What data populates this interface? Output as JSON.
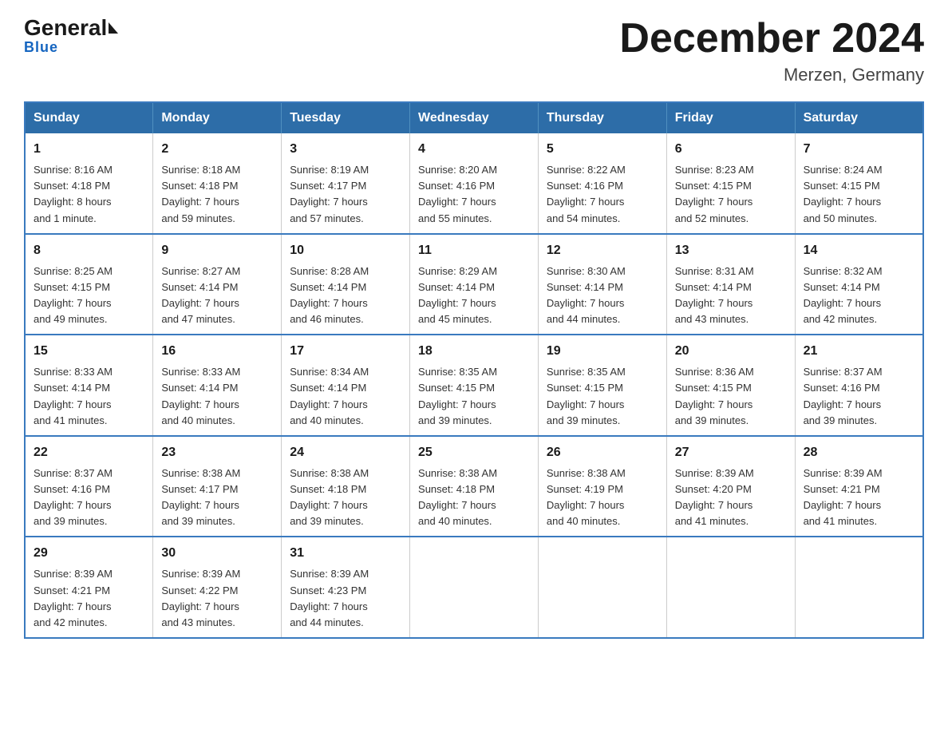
{
  "logo": {
    "text1": "General",
    "text2": "Blue"
  },
  "header": {
    "month_title": "December 2024",
    "location": "Merzen, Germany"
  },
  "days_of_week": [
    "Sunday",
    "Monday",
    "Tuesday",
    "Wednesday",
    "Thursday",
    "Friday",
    "Saturday"
  ],
  "weeks": [
    [
      {
        "day": "1",
        "sunrise": "8:16 AM",
        "sunset": "4:18 PM",
        "daylight": "8 hours and 1 minute."
      },
      {
        "day": "2",
        "sunrise": "8:18 AM",
        "sunset": "4:18 PM",
        "daylight": "7 hours and 59 minutes."
      },
      {
        "day": "3",
        "sunrise": "8:19 AM",
        "sunset": "4:17 PM",
        "daylight": "7 hours and 57 minutes."
      },
      {
        "day": "4",
        "sunrise": "8:20 AM",
        "sunset": "4:16 PM",
        "daylight": "7 hours and 55 minutes."
      },
      {
        "day": "5",
        "sunrise": "8:22 AM",
        "sunset": "4:16 PM",
        "daylight": "7 hours and 54 minutes."
      },
      {
        "day": "6",
        "sunrise": "8:23 AM",
        "sunset": "4:15 PM",
        "daylight": "7 hours and 52 minutes."
      },
      {
        "day": "7",
        "sunrise": "8:24 AM",
        "sunset": "4:15 PM",
        "daylight": "7 hours and 50 minutes."
      }
    ],
    [
      {
        "day": "8",
        "sunrise": "8:25 AM",
        "sunset": "4:15 PM",
        "daylight": "7 hours and 49 minutes."
      },
      {
        "day": "9",
        "sunrise": "8:27 AM",
        "sunset": "4:14 PM",
        "daylight": "7 hours and 47 minutes."
      },
      {
        "day": "10",
        "sunrise": "8:28 AM",
        "sunset": "4:14 PM",
        "daylight": "7 hours and 46 minutes."
      },
      {
        "day": "11",
        "sunrise": "8:29 AM",
        "sunset": "4:14 PM",
        "daylight": "7 hours and 45 minutes."
      },
      {
        "day": "12",
        "sunrise": "8:30 AM",
        "sunset": "4:14 PM",
        "daylight": "7 hours and 44 minutes."
      },
      {
        "day": "13",
        "sunrise": "8:31 AM",
        "sunset": "4:14 PM",
        "daylight": "7 hours and 43 minutes."
      },
      {
        "day": "14",
        "sunrise": "8:32 AM",
        "sunset": "4:14 PM",
        "daylight": "7 hours and 42 minutes."
      }
    ],
    [
      {
        "day": "15",
        "sunrise": "8:33 AM",
        "sunset": "4:14 PM",
        "daylight": "7 hours and 41 minutes."
      },
      {
        "day": "16",
        "sunrise": "8:33 AM",
        "sunset": "4:14 PM",
        "daylight": "7 hours and 40 minutes."
      },
      {
        "day": "17",
        "sunrise": "8:34 AM",
        "sunset": "4:14 PM",
        "daylight": "7 hours and 40 minutes."
      },
      {
        "day": "18",
        "sunrise": "8:35 AM",
        "sunset": "4:15 PM",
        "daylight": "7 hours and 39 minutes."
      },
      {
        "day": "19",
        "sunrise": "8:35 AM",
        "sunset": "4:15 PM",
        "daylight": "7 hours and 39 minutes."
      },
      {
        "day": "20",
        "sunrise": "8:36 AM",
        "sunset": "4:15 PM",
        "daylight": "7 hours and 39 minutes."
      },
      {
        "day": "21",
        "sunrise": "8:37 AM",
        "sunset": "4:16 PM",
        "daylight": "7 hours and 39 minutes."
      }
    ],
    [
      {
        "day": "22",
        "sunrise": "8:37 AM",
        "sunset": "4:16 PM",
        "daylight": "7 hours and 39 minutes."
      },
      {
        "day": "23",
        "sunrise": "8:38 AM",
        "sunset": "4:17 PM",
        "daylight": "7 hours and 39 minutes."
      },
      {
        "day": "24",
        "sunrise": "8:38 AM",
        "sunset": "4:18 PM",
        "daylight": "7 hours and 39 minutes."
      },
      {
        "day": "25",
        "sunrise": "8:38 AM",
        "sunset": "4:18 PM",
        "daylight": "7 hours and 40 minutes."
      },
      {
        "day": "26",
        "sunrise": "8:38 AM",
        "sunset": "4:19 PM",
        "daylight": "7 hours and 40 minutes."
      },
      {
        "day": "27",
        "sunrise": "8:39 AM",
        "sunset": "4:20 PM",
        "daylight": "7 hours and 41 minutes."
      },
      {
        "day": "28",
        "sunrise": "8:39 AM",
        "sunset": "4:21 PM",
        "daylight": "7 hours and 41 minutes."
      }
    ],
    [
      {
        "day": "29",
        "sunrise": "8:39 AM",
        "sunset": "4:21 PM",
        "daylight": "7 hours and 42 minutes."
      },
      {
        "day": "30",
        "sunrise": "8:39 AM",
        "sunset": "4:22 PM",
        "daylight": "7 hours and 43 minutes."
      },
      {
        "day": "31",
        "sunrise": "8:39 AM",
        "sunset": "4:23 PM",
        "daylight": "7 hours and 44 minutes."
      },
      null,
      null,
      null,
      null
    ]
  ],
  "labels": {
    "sunrise": "Sunrise:",
    "sunset": "Sunset:",
    "daylight": "Daylight:"
  }
}
